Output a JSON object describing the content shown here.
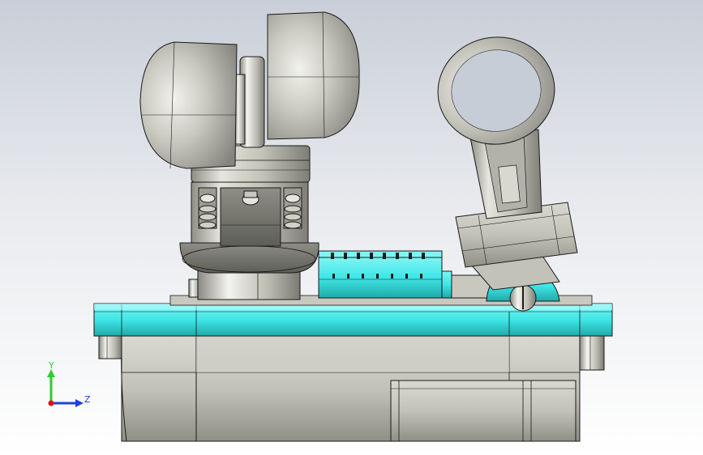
{
  "viewport": {
    "background_top": "#c9ced8",
    "background_bottom": "#ffffff"
  },
  "model": {
    "body_color": "#c2c2b8",
    "body_shade": "#9c9c92",
    "accent_color": "#3fe6e6",
    "accent_shade": "#22b8b8",
    "edge_color": "#1a1a1a"
  },
  "triad": {
    "y_label": "Y",
    "z_label": "Z",
    "y_color": "#2ecc2e",
    "z_color": "#2040e0",
    "origin_color": "#e01010"
  }
}
